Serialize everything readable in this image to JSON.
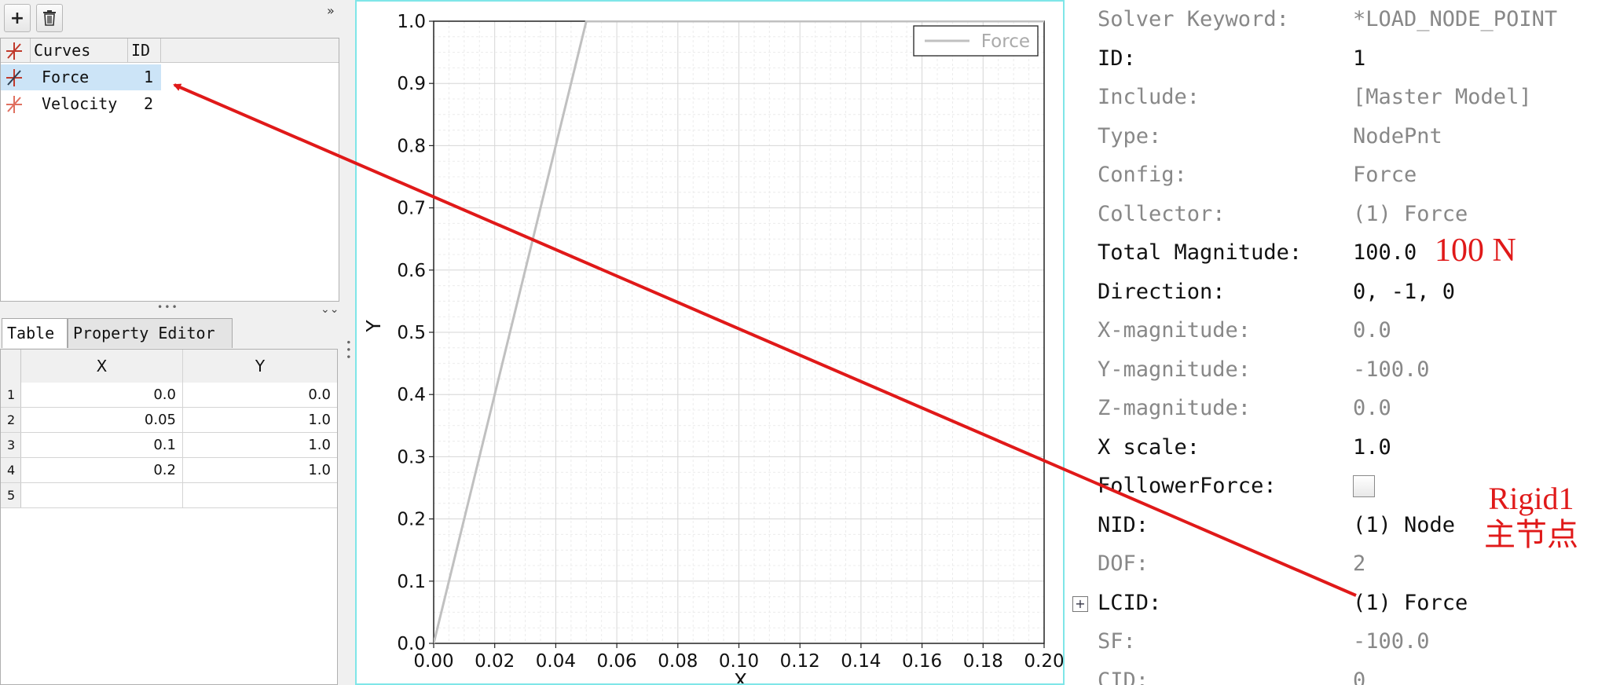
{
  "toolbar": {
    "add_icon": "plus-icon",
    "add_glyph": "+",
    "delete_icon": "trash-icon",
    "collapse_glyph": "»"
  },
  "curve_list": {
    "headers": {
      "curves": "Curves",
      "id": "ID"
    },
    "items": [
      {
        "name": "Force",
        "id": "1",
        "selected": true,
        "icon": "curve-icon",
        "icon_color": "#c0392b"
      },
      {
        "name": "Velocity",
        "id": "2",
        "selected": false,
        "icon": "curve-icon",
        "icon_color": "#e07060"
      }
    ]
  },
  "tabs": [
    {
      "label": "Table"
    },
    {
      "label": "Property Editor"
    }
  ],
  "table": {
    "headers": {
      "x": "X",
      "y": "Y"
    },
    "rows": [
      {
        "n": "1",
        "x": "0.0",
        "y": "0.0"
      },
      {
        "n": "2",
        "x": "0.05",
        "y": "1.0"
      },
      {
        "n": "3",
        "x": "0.1",
        "y": "1.0"
      },
      {
        "n": "4",
        "x": "0.2",
        "y": "1.0"
      },
      {
        "n": "5",
        "x": "",
        "y": ""
      }
    ]
  },
  "chart_data": {
    "type": "line",
    "xlabel": "X",
    "ylabel": "Y",
    "xlim": [
      0.0,
      0.2
    ],
    "ylim": [
      0.0,
      1.0
    ],
    "x_ticks": [
      "0.00",
      "0.02",
      "0.04",
      "0.06",
      "0.08",
      "0.10",
      "0.12",
      "0.14",
      "0.16",
      "0.18",
      "0.20"
    ],
    "y_ticks": [
      "0.0",
      "0.1",
      "0.2",
      "0.3",
      "0.4",
      "0.5",
      "0.6",
      "0.7",
      "0.8",
      "0.9",
      "1.0"
    ],
    "grid": true,
    "legend_position": "top-right",
    "series": [
      {
        "name": "Force",
        "x": [
          0.0,
          0.05,
          0.1,
          0.2
        ],
        "y": [
          0.0,
          1.0,
          1.0,
          1.0
        ],
        "color": "#c0c0c0"
      }
    ]
  },
  "properties": {
    "rows": [
      {
        "label": "Solver Keyword:",
        "value": "*LOAD_NODE_POINT",
        "dim": true
      },
      {
        "label": "ID:",
        "value": "1",
        "dim": false
      },
      {
        "label": "Include:",
        "value": "[Master Model]",
        "dim": true
      },
      {
        "label": "Type:",
        "value": "NodePnt",
        "dim": true
      },
      {
        "label": "Config:",
        "value": "Force",
        "dim": true
      },
      {
        "label": "Collector:",
        "value": "(1) Force",
        "dim": true
      },
      {
        "label": "Total Magnitude:",
        "value": "100.0",
        "dim": false
      },
      {
        "label": "Direction:",
        "value": "0, -1, 0",
        "dim": false
      },
      {
        "label": "X-magnitude:",
        "value": "0.0",
        "dim": true
      },
      {
        "label": "Y-magnitude:",
        "value": "-100.0",
        "dim": true
      },
      {
        "label": "Z-magnitude:",
        "value": "0.0",
        "dim": true
      },
      {
        "label": "X scale:",
        "value": "1.0",
        "dim": false
      },
      {
        "label": "FollowerForce:",
        "value": "",
        "dim": false,
        "checkbox": true,
        "checked": false
      },
      {
        "label": "NID:",
        "value": "(1) Node",
        "dim": false
      },
      {
        "label": "DOF:",
        "value": "2",
        "dim": true
      },
      {
        "label": "LCID:",
        "value": "(1) Force",
        "dim": false,
        "expandable": true
      },
      {
        "label": "SF:",
        "value": "-100.0",
        "dim": true
      },
      {
        "label": "CID:",
        "value": "0",
        "dim": true
      }
    ]
  },
  "annotations": {
    "magnitude_note": "100 N",
    "node_note_line1": "Rigid1",
    "node_note_line2": "主节点",
    "arrow_color": "#e01919"
  }
}
